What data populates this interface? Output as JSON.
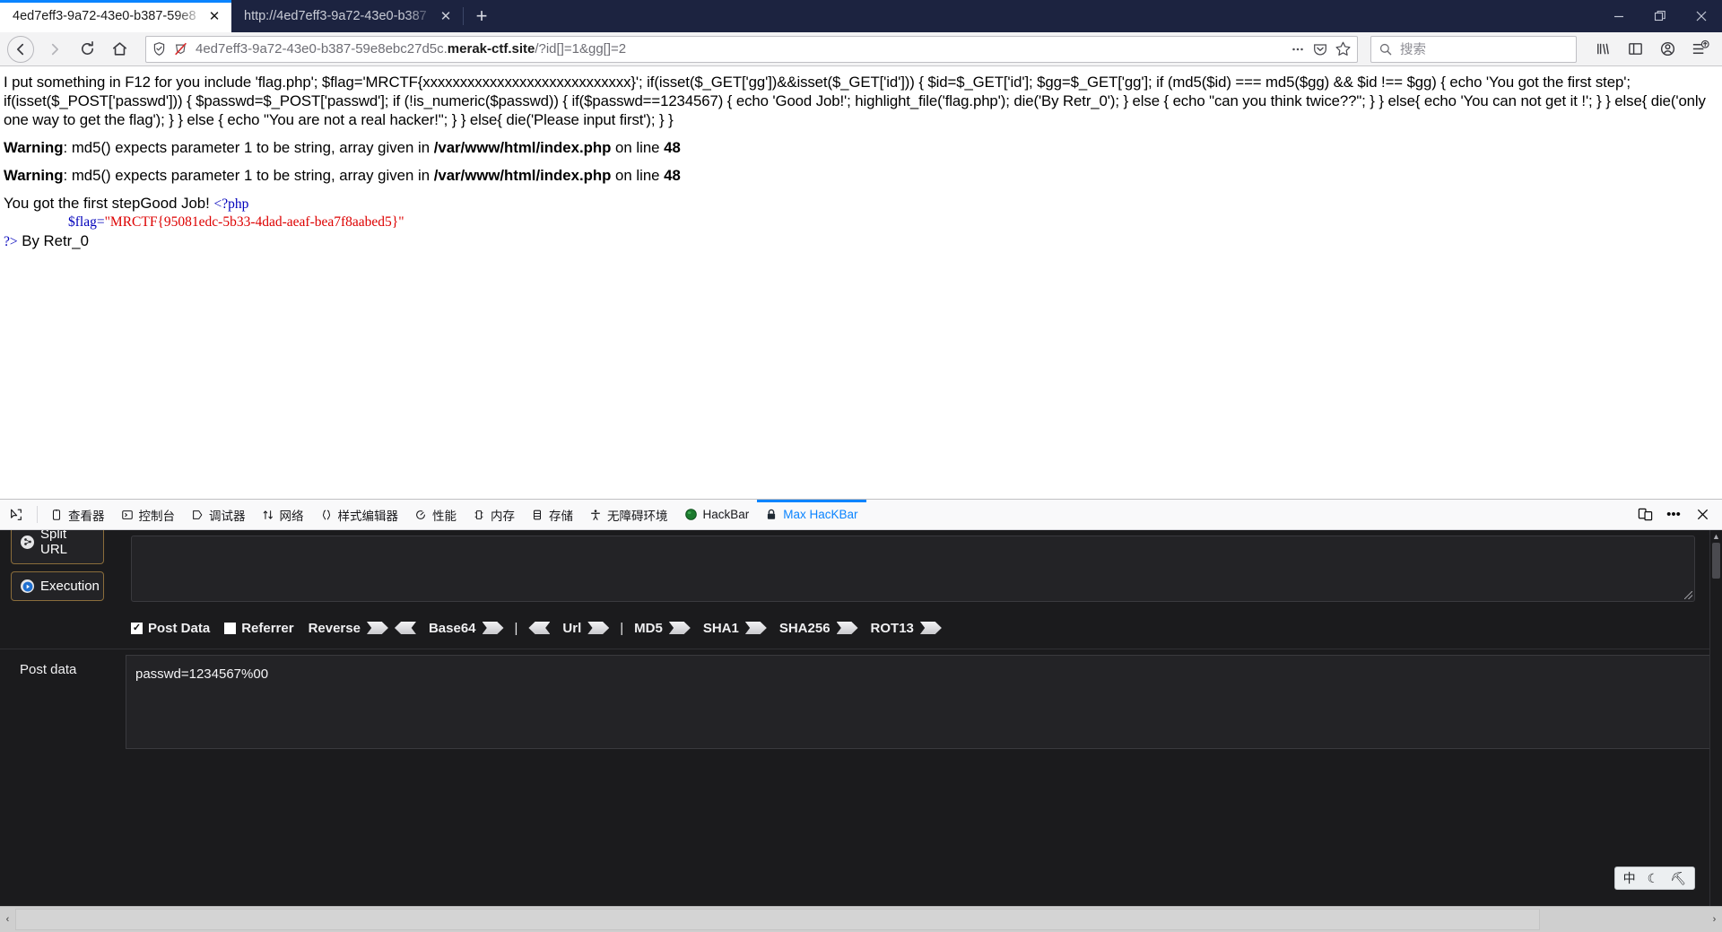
{
  "window": {
    "minimize_label": "—",
    "restore_label": "❐",
    "close_label": "✕"
  },
  "tabs": [
    {
      "title": "4ed7eff3-9a72-43e0-b387-59e8",
      "close_label": "✕",
      "active": true
    },
    {
      "title": "http://4ed7eff3-9a72-43e0-b387",
      "close_label": "✕",
      "active": false
    }
  ],
  "newtab_label": "+",
  "nav": {
    "back_label": "←",
    "forward_label": "→",
    "reload_label": "⟳",
    "home_label": "⌂",
    "url_prefix": "4ed7eff3-9a72-43e0-b387-59e8ebc27d5c.",
    "url_domain": "merak-ctf.site",
    "url_path": "/?id[]=1&gg[]=2",
    "shield_icon": "shield-icon",
    "tracking_icon": "tracking-protection-off-icon",
    "page_actions_label": "•••",
    "pocket_icon": "pocket-icon",
    "bookmark_icon": "star-icon"
  },
  "search": {
    "placeholder": "搜索",
    "search_icon": "search-icon"
  },
  "toolbar_right": {
    "library_icon": "library-icon",
    "sidebar_icon": "sidebar-icon",
    "account_icon": "account-icon",
    "menu_icon": "hamburger-menu-icon"
  },
  "page": {
    "source_dump": "I put something in F12 for you include 'flag.php'; $flag='MRCTF{xxxxxxxxxxxxxxxxxxxxxxxxxxxx}'; if(isset($_GET['gg'])&&isset($_GET['id'])) { $id=$_GET['id']; $gg=$_GET['gg']; if (md5($id) === md5($gg) && $id !== $gg) { echo 'You got the first step'; if(isset($_POST['passwd'])) { $passwd=$_POST['passwd']; if (!is_numeric($passwd)) { if($passwd==1234567) { echo 'Good Job!'; highlight_file('flag.php'); die('By Retr_0'); } else { echo \"can you think twice??\"; } } else{ echo 'You can not get it !'; } } else{ die('only one way to get the flag'); } } else { echo \"You are not a real hacker!\"; } } else{ die('Please input first'); } }",
    "warnings": [
      {
        "label": "Warning",
        "text": ": md5() expects parameter 1 to be string, array given in ",
        "file": "/var/www/html/index.php",
        "online": " on line ",
        "line": "48"
      },
      {
        "label": "Warning",
        "text": ": md5() expects parameter 1 to be string, array given in ",
        "file": "/var/www/html/index.php",
        "online": " on line ",
        "line": "48"
      }
    ],
    "step_text": "You got the first stepGood Job!",
    "php_open": "<?php",
    "php_var": "$flag=",
    "php_quote_open": "\"",
    "php_flag_value": "MRCTF{95081edc-5b33-4dad-aeaf-bea7f8aabed5}",
    "php_quote_close": "\"",
    "php_close": "?>",
    "byline": " By Retr_0"
  },
  "devtools": {
    "picker_icon": "element-picker-icon",
    "tools": [
      {
        "label": "查看器",
        "icon": "inspector-icon",
        "selected": false
      },
      {
        "label": "控制台",
        "icon": "console-icon",
        "selected": false
      },
      {
        "label": "调试器",
        "icon": "debugger-icon",
        "selected": false
      },
      {
        "label": "网络",
        "icon": "network-icon",
        "selected": false
      },
      {
        "label": "样式编辑器",
        "icon": "style-editor-icon",
        "selected": false
      },
      {
        "label": "性能",
        "icon": "performance-icon",
        "selected": false
      },
      {
        "label": "内存",
        "icon": "memory-icon",
        "selected": false
      },
      {
        "label": "存储",
        "icon": "storage-icon",
        "selected": false
      },
      {
        "label": "无障碍环境",
        "icon": "accessibility-icon",
        "selected": false
      },
      {
        "label": "HackBar",
        "icon": "hackbar-icon",
        "selected": false
      },
      {
        "label": "Max HacKBar",
        "icon": "max-hackbar-lock-icon",
        "selected": true
      }
    ],
    "responsive_icon": "responsive-design-mode-icon",
    "meatball_label": "•••",
    "close_label": "✕"
  },
  "hackbar": {
    "split_url_label": "Split URL",
    "execution_label": "Execution",
    "url_value": "",
    "checkboxes": [
      {
        "label": "Post Data",
        "checked": true,
        "check_glyph": "✓"
      },
      {
        "label": "Referrer",
        "checked": false,
        "check_glyph": ""
      }
    ],
    "encoders": [
      {
        "label": "Reverse",
        "arrows": [
          "right",
          "left"
        ]
      },
      {
        "label": "Base64",
        "arrows": [
          "right"
        ]
      },
      {
        "label": "Url",
        "arrows": [
          "right"
        ]
      },
      {
        "label": "MD5",
        "arrows": [
          "right"
        ]
      },
      {
        "label": "SHA1",
        "arrows": [
          "right"
        ]
      },
      {
        "label": "SHA256",
        "arrows": [
          "right"
        ]
      },
      {
        "label": "ROT13",
        "arrows": [
          "right"
        ]
      }
    ],
    "pipe": "|",
    "post_data_label": "Post data",
    "post_data_value": "passwd=1234567%00"
  },
  "ime": {
    "mode_label": "中",
    "punct_label": "☾",
    "tool_label": "⛏"
  },
  "scrollbar": {
    "left_label": "‹",
    "right_label": "›",
    "up_label": "▲",
    "down_label": "▼"
  },
  "colors": {
    "accent": "#0a84ff",
    "titlebar": "#1c2340",
    "devtools_bg": "#1b1b1d",
    "php_string": "#dd0000",
    "php_keyword": "#0000bb"
  }
}
